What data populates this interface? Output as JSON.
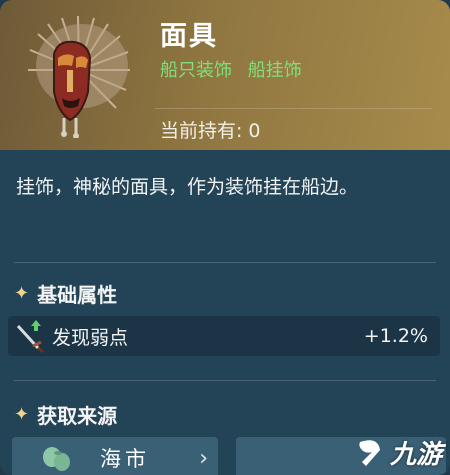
{
  "item": {
    "name": "面具",
    "tags": [
      "船只装饰",
      "船挂饰"
    ],
    "owned_label": "当前持有:",
    "owned_value": "0",
    "icon": "tribal-mask-icon"
  },
  "description": "挂饰，神秘的面具，作为装饰挂在船边。",
  "base_attributes": {
    "title": "基础属性",
    "stats": [
      {
        "icon": "sword-up-icon",
        "label": "发现弱点",
        "value": "+1.2%"
      }
    ]
  },
  "sources": {
    "title": "获取来源",
    "buttons": [
      {
        "icon": "bag-icon",
        "label": "海市",
        "chevron": "›"
      }
    ]
  },
  "watermark": {
    "text": "九游",
    "icon": "9you-logo-icon"
  },
  "colors": {
    "header_gold": "#8f7640",
    "panel_blue": "#234356",
    "tag_green": "#7fe07a",
    "star_gold": "#f1d48a",
    "button_blue": "#3a6076"
  }
}
